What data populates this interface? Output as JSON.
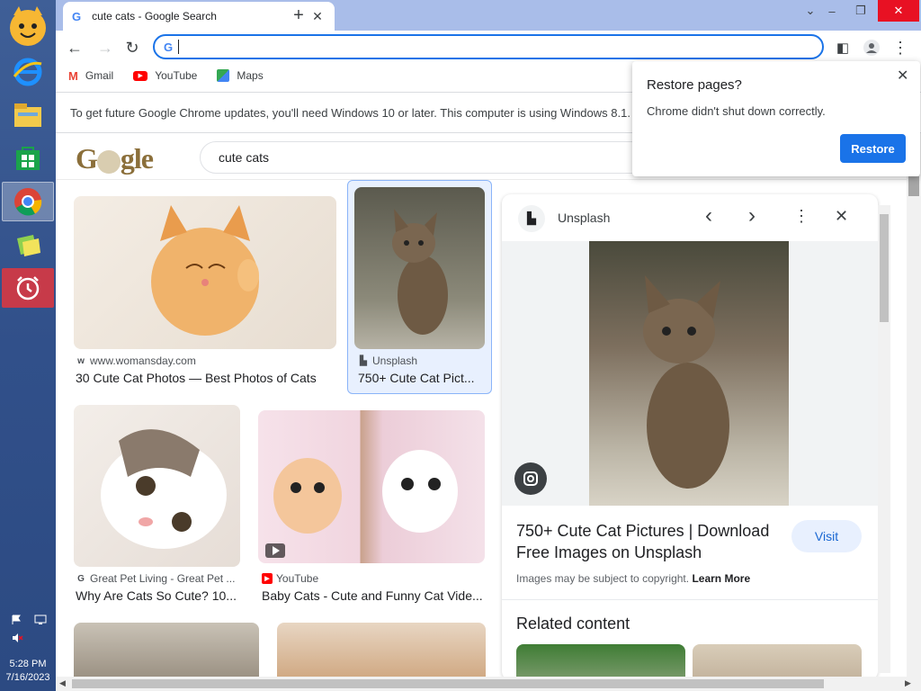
{
  "taskbar": {
    "items": [
      {
        "icon": "hamster-app-icon"
      },
      {
        "icon": "internet-explorer-icon"
      },
      {
        "icon": "file-explorer-icon"
      },
      {
        "icon": "store-icon"
      },
      {
        "icon": "chrome-icon"
      },
      {
        "icon": "notes-app-icon"
      },
      {
        "icon": "alarm-clock-icon"
      }
    ],
    "time": "5:28 PM",
    "date": "7/16/2023"
  },
  "tab": {
    "title": "cute cats - Google Search"
  },
  "bookmarks": [
    {
      "label": "Gmail",
      "color": "#ea4335"
    },
    {
      "label": "YouTube",
      "color": "#ff0000"
    },
    {
      "label": "Maps",
      "color": "#34a853"
    }
  ],
  "infobar": {
    "text": "To get future Google Chrome updates, you'll need Windows 10 or later. This computer is using Windows 8.1."
  },
  "search": {
    "query": "cute cats",
    "logo": "Google"
  },
  "results": [
    {
      "source": "www.womansday.com",
      "caption": "30 Cute Cat Photos — Best Photos of Cats"
    },
    {
      "source": "Unsplash",
      "caption": "750+ Cute Cat Pict..."
    },
    {
      "source": "Great Pet Living - Great Pet ...",
      "caption": "Why Are Cats So Cute? 10..."
    },
    {
      "source": "YouTube",
      "caption": "Baby Cats - Cute and Funny Cat Vide..."
    }
  ],
  "panel": {
    "source": "Unsplash",
    "title": "750+ Cute Cat Pictures | Download Free Images on Unsplash",
    "visit": "Visit",
    "copyright": "Images may be subject to copyright.",
    "learn_more": "Learn More",
    "related": "Related content"
  },
  "restore": {
    "title": "Restore pages?",
    "message": "Chrome didn't shut down correctly.",
    "button": "Restore"
  },
  "colors": {
    "accent": "#1a73e8",
    "titlebar": "#a9bde9",
    "taskbar": "#31508a"
  }
}
